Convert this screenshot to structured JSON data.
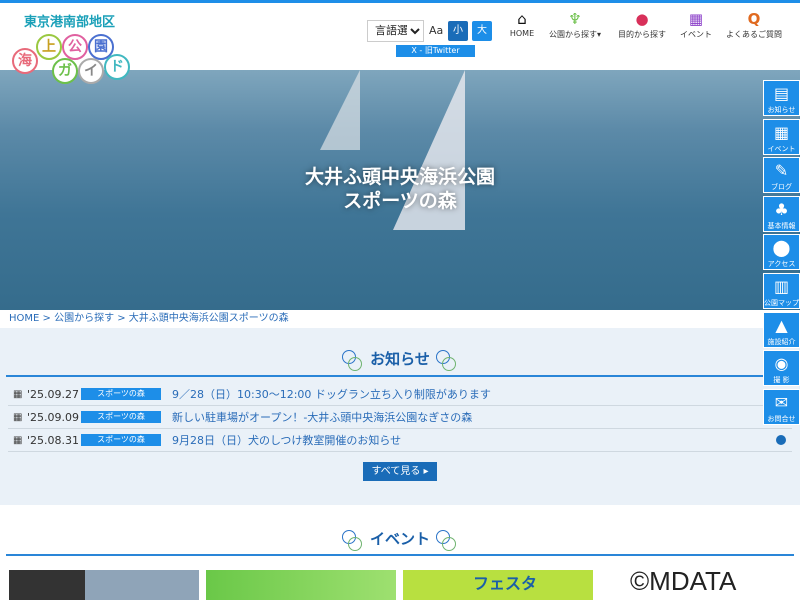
{
  "header": {
    "site_name": "東京港南部地区",
    "logo_chars": [
      "海",
      "上",
      "公",
      "園",
      "ガ",
      "イ",
      "ド"
    ],
    "language_select": "言語選択",
    "font_size_label": "Aa",
    "font_small": "小",
    "font_large": "大",
    "twitter": "X - 旧Twitter",
    "nav": [
      {
        "label": "HOME",
        "icon": "home-icon"
      },
      {
        "label": "公園から探す▾",
        "icon": "sprout-icon"
      },
      {
        "label": "目的から探す",
        "icon": "ball-icon"
      },
      {
        "label": "イベント",
        "icon": "calendar-icon"
      },
      {
        "label": "よくあるご質問",
        "icon": "q-icon"
      }
    ]
  },
  "hero": {
    "title_line1": "大井ふ頭中央海浜公園",
    "title_line2": "スポーツの森"
  },
  "breadcrumb": "HOME > 公園から探す > 大井ふ頭中央海浜公園スポーツの森",
  "news": {
    "title": "お知らせ",
    "items": [
      {
        "date": "'25.09.27",
        "tag": "スポーツの森",
        "text": "9／28（日）10:30～12:00 ドッグラン立ち入り制限があります"
      },
      {
        "date": "'25.09.09",
        "tag": "スポーツの森",
        "text": "新しい駐車場がオープン！-大井ふ頭中央海浜公園なぎさの森"
      },
      {
        "date": "'25.08.31",
        "tag": "スポーツの森",
        "text": "9月28日（日）犬のしつけ教室開催のお知らせ"
      }
    ],
    "more": "すべて見る ▸"
  },
  "events": {
    "title": "イベント",
    "thumb3_text": "フェスタ"
  },
  "sidebar": [
    {
      "label": "お知らせ",
      "icon": "▤"
    },
    {
      "label": "イベント",
      "icon": "▦"
    },
    {
      "label": "ブログ",
      "icon": "✎"
    },
    {
      "label": "基本情報",
      "icon": "♣"
    },
    {
      "label": "アクセス",
      "icon": "⬤"
    },
    {
      "label": "公園マップ",
      "icon": "▥"
    },
    {
      "label": "施設紹介",
      "icon": "▲"
    },
    {
      "label": "撮 影",
      "icon": "◉"
    },
    {
      "label": "お問合せ",
      "icon": "✉"
    }
  ],
  "watermark": "©MDATA",
  "colors": {
    "accent": "#1d8ee8",
    "heading": "#1a5fa8",
    "news_bg": "#eaf1f8"
  }
}
